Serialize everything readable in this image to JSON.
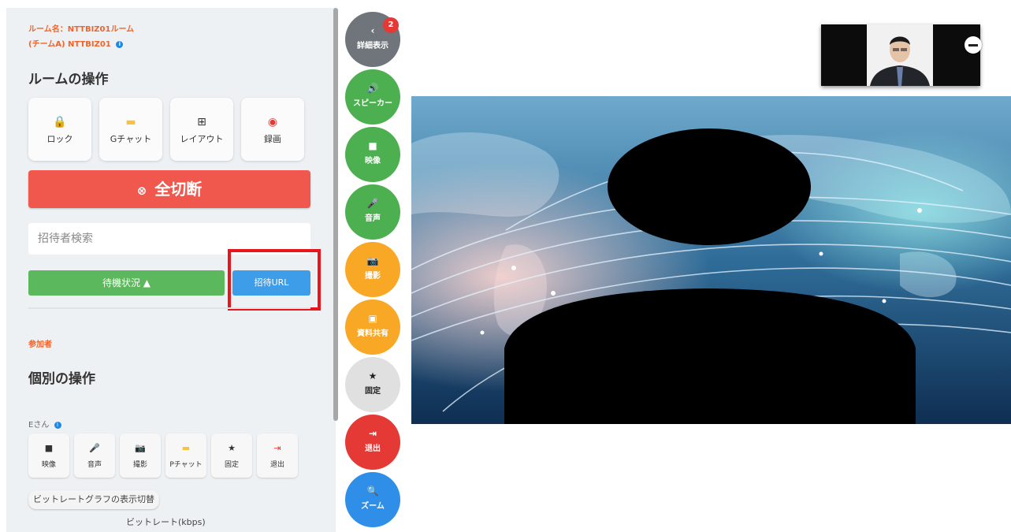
{
  "room": {
    "name_line1": "ルーム名：NTTBIZ01ルーム",
    "name_line2": "(チームA) NTTBIZ01",
    "info_glyph": "i",
    "operations_heading": "ルームの操作",
    "operations": [
      {
        "icon": "lock-icon",
        "glyph": "🔒",
        "color": "#e53935",
        "label": "ロック"
      },
      {
        "icon": "group-chat-icon",
        "glyph": "▬",
        "color": "#f5c542",
        "label": "Gチャット"
      },
      {
        "icon": "layout-grid-icon",
        "glyph": "⊞",
        "color": "#333333",
        "label": "レイアウト"
      },
      {
        "icon": "record-icon",
        "glyph": "◉",
        "color": "#e53935",
        "label": "録画"
      }
    ],
    "disconnect_all": {
      "icon_glyph": "⊗",
      "label": "全切断"
    },
    "invitee_search_placeholder": "招待者検索",
    "wait_status_label": "待機状況 ▲",
    "invite_url_label": "招待URL"
  },
  "participants": {
    "section_label": "参加者",
    "individual_heading": "個別の操作",
    "user_name": "Eさん",
    "info_glyph": "i",
    "user_operations": [
      {
        "icon": "video-icon",
        "glyph": "■",
        "color": "#222222",
        "label": "映像"
      },
      {
        "icon": "mic-icon",
        "glyph": "🎤",
        "color": "#222222",
        "label": "音声"
      },
      {
        "icon": "camera-icon",
        "glyph": "📷",
        "color": "#222222",
        "label": "撮影"
      },
      {
        "icon": "private-chat-icon",
        "glyph": "▬",
        "color": "#f5c542",
        "label": "Pチャット"
      },
      {
        "icon": "star-icon",
        "glyph": "★",
        "color": "#222222",
        "label": "固定"
      },
      {
        "icon": "exit-icon",
        "glyph": "⇥",
        "color": "#e53935",
        "label": "退出"
      }
    ],
    "bitrate_toggle_label": "ビットレートグラフの表示切替",
    "bitrate_title": "ビットレート(kbps)"
  },
  "controls": [
    {
      "name": "details-button",
      "icon": "chevron-left-icon",
      "glyph": "‹",
      "label": "詳細表示",
      "color": "#6f757a",
      "badge": "2"
    },
    {
      "name": "speaker-button",
      "icon": "speaker-icon",
      "glyph": "🔊",
      "label": "スピーカー",
      "color": "#4caf50"
    },
    {
      "name": "video-button",
      "icon": "video-icon",
      "glyph": "■",
      "label": "映像",
      "color": "#4caf50"
    },
    {
      "name": "audio-button",
      "icon": "mic-icon",
      "glyph": "🎤",
      "label": "音声",
      "color": "#4caf50"
    },
    {
      "name": "capture-button",
      "icon": "camera-icon",
      "glyph": "📷",
      "label": "撮影",
      "color": "#f9a825"
    },
    {
      "name": "share-material-button",
      "icon": "share-screen-icon",
      "glyph": "▣",
      "label": "資料共有",
      "color": "#f9a825"
    },
    {
      "name": "pin-button",
      "icon": "star-icon",
      "glyph": "★",
      "label": "固定",
      "color": "#e0e0e0",
      "text_color": "#222222"
    },
    {
      "name": "leave-button",
      "icon": "exit-icon",
      "glyph": "⇥",
      "label": "退出",
      "color": "#e53935"
    },
    {
      "name": "zoom-button",
      "icon": "zoom-icon",
      "glyph": "🔍",
      "label": "ズーム",
      "color": "#2f8fe8"
    }
  ],
  "colors": {
    "accent_orange": "#f0642c",
    "disconnect_red": "#f0584d",
    "wait_green": "#5cb85c",
    "invite_blue": "#3d9de8",
    "highlight_red": "#e8161c"
  }
}
